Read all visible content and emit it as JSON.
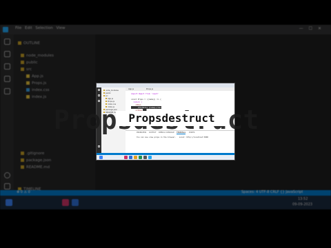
{
  "background": {
    "menu": [
      "File",
      "Edit",
      "Selection",
      "View"
    ],
    "window_controls": [
      "—",
      "☐",
      "✕"
    ],
    "explorer_rows": [
      {
        "label": "OUTLINE",
        "type": "folder"
      },
      {
        "label": "node_modules",
        "type": "folder"
      },
      {
        "label": "public",
        "type": "folder"
      },
      {
        "label": "src",
        "type": "folder"
      },
      {
        "label": "App.js",
        "type": "js"
      },
      {
        "label": "Props.js",
        "type": "js"
      },
      {
        "label": "index.css",
        "type": "css"
      },
      {
        "label": "index.js",
        "type": "js"
      },
      {
        "label": ".gitignore",
        "type": "file"
      },
      {
        "label": "package.json",
        "type": "file"
      },
      {
        "label": "README.md",
        "type": "file"
      },
      {
        "label": "TIMELINE",
        "type": "folder"
      }
    ],
    "status_left": "⊗ 0 ⚠ 0",
    "status_right": "Spaces: 4  UTF-8  CRLF  {} JavaScript",
    "clock_time": "13:52",
    "clock_date": "09-09-2023"
  },
  "screenshot": {
    "tabs": [
      "App.js",
      "Props.js"
    ],
    "explorer_rows": [
      "node_modules",
      "public",
      "src",
      "App.js",
      "Props.js",
      "index.css",
      "index.js",
      "package.json",
      "README.md"
    ],
    "code_lines": [
      {
        "text": "import React from 'react'",
        "kind": "kw"
      },
      {
        "text": "",
        "kind": "plain"
      },
      {
        "text": "const Props = ({name}) => {",
        "kind": "plain"
      },
      {
        "text": "  return (",
        "kind": "kw"
      },
      {
        "text": "    <div>",
        "kind": "tg"
      },
      {
        "text": "      <h1>Hello {name}</h1>",
        "kind": "hl"
      },
      {
        "text": "    </div>",
        "kind": "tg"
      },
      {
        "text": "  )",
        "kind": "plain"
      },
      {
        "text": "}",
        "kind": "plain"
      },
      {
        "text": "export default Props",
        "kind": "kw"
      }
    ],
    "terminal_tabs": [
      "PROBLEMS",
      "OUTPUT",
      "DEBUG CONSOLE",
      "TERMINAL",
      "PORTS"
    ],
    "terminal_line": "You can now view props in the browser.   Local: http://localhost:3000"
  },
  "caption": {
    "ghost_text": "Propsdestruct",
    "text": "Propsdestruct"
  }
}
